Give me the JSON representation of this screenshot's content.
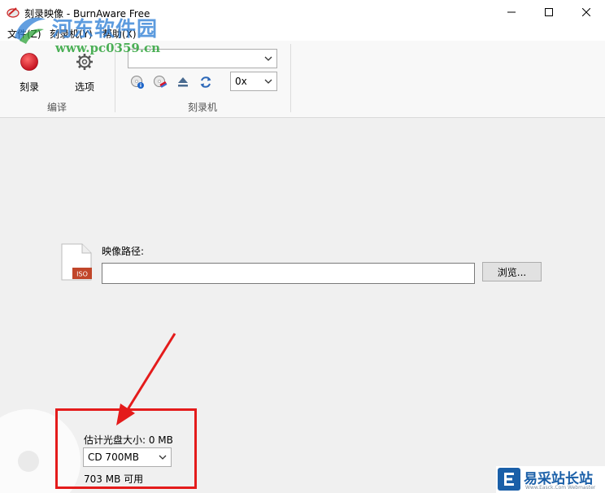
{
  "window": {
    "title": "刻录映像 - BurnAware Free",
    "minimize_icon": "minimize-icon",
    "maximize_icon": "maximize-icon",
    "close_icon": "close-icon"
  },
  "menu": {
    "items": [
      "文件(Z)",
      "刻录机(Y)",
      "帮助(X)"
    ]
  },
  "watermark": {
    "site_name": "河东软件园",
    "url": "www.pc0359.cn"
  },
  "ribbon": {
    "groups": [
      {
        "label": "编译",
        "buttons": [
          {
            "label": "刻录",
            "icon": "record-icon"
          },
          {
            "label": "选项",
            "icon": "gear-icon"
          }
        ]
      },
      {
        "label": "刻录机",
        "drive_selected": "",
        "speed_selected": "0x",
        "tool_icons": [
          "disc-info-icon",
          "erase-disc-icon",
          "eject-icon",
          "refresh-icon"
        ]
      }
    ]
  },
  "main": {
    "image_path_label": "映像路径:",
    "image_path_value": "",
    "browse_label": "浏览...",
    "file_icon_badge": "ISO",
    "estimated_size_label": "估计光盘大小: 0 MB",
    "disc_type_selected": "CD 700MB",
    "available_label": "703 MB 可用"
  },
  "corner_logo": {
    "name": "易采站长站",
    "tagline": "Www.Easck.Com Webmaster"
  },
  "colors": {
    "annotation_red": "#e41b1b",
    "watermark_blue": "#2f7fd6",
    "watermark_green": "#2ea33a",
    "record_red": "#d8152a"
  }
}
